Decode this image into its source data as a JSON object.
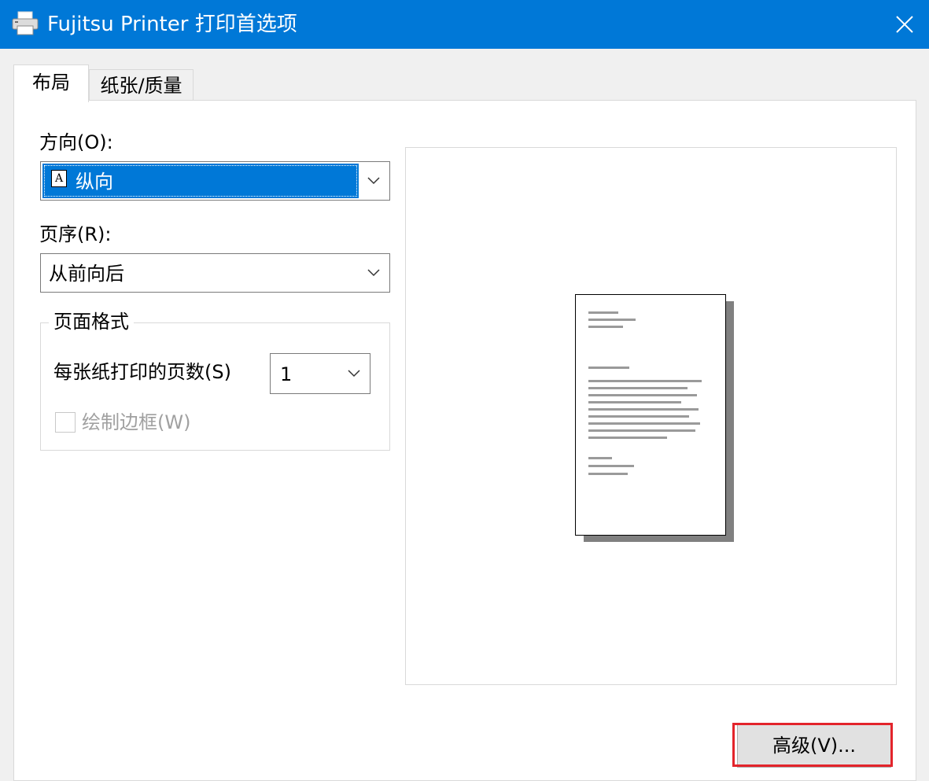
{
  "window": {
    "title": "Fujitsu Printer 打印首选项"
  },
  "icons": {
    "app": "printer-icon",
    "close": "close-icon",
    "orientation": "portrait-page-icon",
    "dropdown": "chevron-down-icon"
  },
  "colors": {
    "titlebar": "#0078d7",
    "selection": "#0078d7",
    "highlight_border": "#e3242b"
  },
  "tabs": [
    {
      "label": "布局",
      "selected": true
    },
    {
      "label": "纸张/质量",
      "selected": false
    }
  ],
  "layout": {
    "orientation": {
      "label": "方向(O):",
      "value": "纵向",
      "icon_glyph": "A"
    },
    "page_order": {
      "label": "页序(R):",
      "value": "从前向后"
    },
    "page_format": {
      "legend": "页面格式",
      "pages_per_sheet_label": "每张纸打印的页数(S)",
      "pages_per_sheet_value": "1",
      "draw_borders_label": "绘制边框(W)",
      "draw_borders_checked": false,
      "draw_borders_enabled": false
    },
    "advanced_button": "高级(V)..."
  }
}
